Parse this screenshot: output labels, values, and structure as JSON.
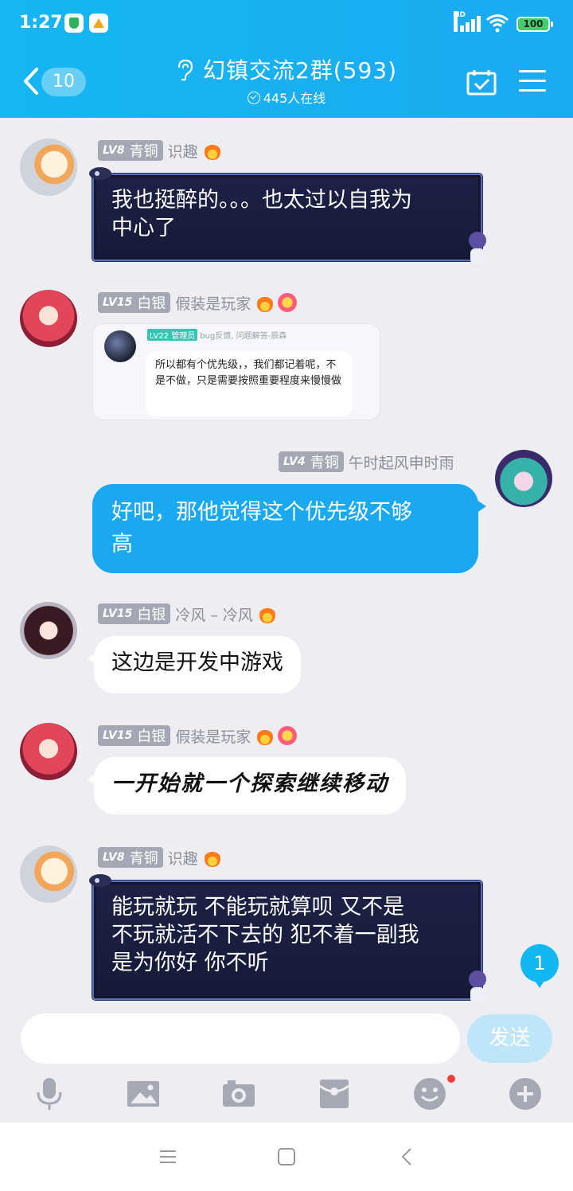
{
  "status_bar": {
    "time": "1:27",
    "network": "HD",
    "battery": "100"
  },
  "header": {
    "back_count": "10",
    "title": "幻镇交流2群(593)",
    "online": "445人在线"
  },
  "messages": [
    {
      "level": "LV8",
      "rank": "青铜",
      "nick": "识趣",
      "text_line1": "我也挺醉的。。。也太过以自我为",
      "text_line2": "中心了"
    },
    {
      "level": "LV15",
      "rank": "白银",
      "nick": "假装是玩家",
      "quote": {
        "level": "LV22",
        "role": "管理员",
        "nick": "bug反馈, 问题解答-辰森",
        "text": "所以都有个优先级，，我们都记着呢，不是不做，只是需要按照重要程度来慢慢做"
      }
    },
    {
      "level": "LV4",
      "rank": "青铜",
      "nick": "午时起风申时雨",
      "text_line1": "好吧，那他觉得这个优先级不够",
      "text_line2": "高"
    },
    {
      "level": "LV15",
      "rank": "白银",
      "nick": "冷风 – 冷风",
      "text": "这边是开发中游戏"
    },
    {
      "level": "LV15",
      "rank": "白银",
      "nick": "假装是玩家",
      "text": "一开始就一个探索继续移动"
    },
    {
      "level": "LV8",
      "rank": "青铜",
      "nick": "识趣",
      "text_line1": "能玩就玩 不能玩就算呗  又不是",
      "text_line2": "不玩就活不下去的  犯不着一副我",
      "text_line3": "是为你好 你不听"
    }
  ],
  "new_message_count": "1",
  "input": {
    "placeholder": "",
    "send_label": "发送"
  },
  "toolbar_icons": [
    "mic-icon",
    "image-icon",
    "camera-icon",
    "red-packet-icon",
    "emoji-icon",
    "plus-icon"
  ],
  "colors": {
    "header": "#16b6f2",
    "blue_bubble": "#1aa8f1",
    "dark_bubble": "#1d2146",
    "level_badge": "#a3a8b4"
  }
}
